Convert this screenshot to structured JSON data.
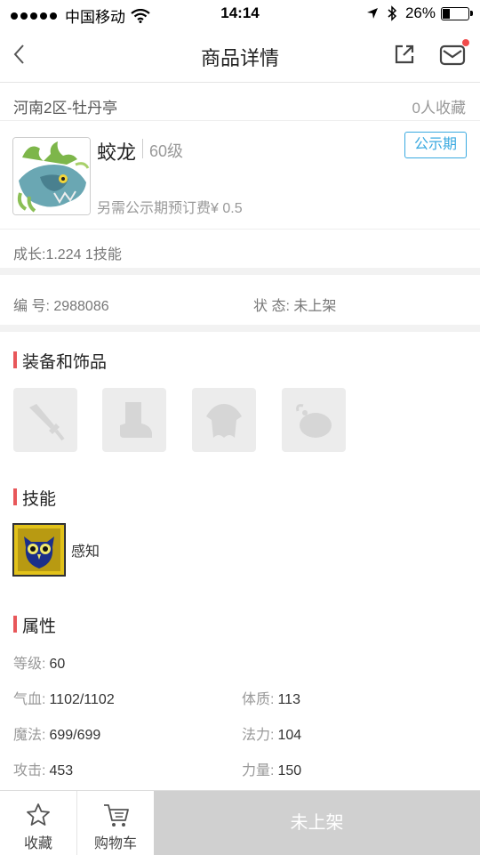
{
  "status_bar": {
    "carrier": "中国移动",
    "time": "14:14",
    "battery": "26%",
    "battery_level": 0.26
  },
  "nav": {
    "title": "商品详情",
    "back_icon": "chevron-left-icon",
    "share_icon": "share-icon",
    "mail_icon": "mail-icon"
  },
  "server": {
    "name": "河南2区-牡丹亭",
    "favorites": "0人收藏"
  },
  "pet": {
    "name": "蛟龙",
    "level": "60级",
    "badge": "公示期",
    "fee": "另需公示期预订费¥ 0.5",
    "growth": "成长:1.224 1技能"
  },
  "meta": {
    "id": "编 号:  2988086",
    "status": "状 态:  未上架"
  },
  "sections": {
    "equipment": "装备和饰品",
    "skills": "技能",
    "attributes": "属性"
  },
  "equipment": [
    {
      "icon": "sword-icon"
    },
    {
      "icon": "boot-icon"
    },
    {
      "icon": "armor-icon"
    },
    {
      "icon": "pouch-icon"
    }
  ],
  "skills": [
    {
      "name": "感知",
      "icon": "owl-icon"
    }
  ],
  "attributes": {
    "level": {
      "label": "等级:",
      "value": "60"
    },
    "hp": {
      "label": "气血:",
      "value": "1102/1102"
    },
    "constitution": {
      "label": "体质:",
      "value": "113"
    },
    "mp": {
      "label": "魔法:",
      "value": "699/699"
    },
    "magic": {
      "label": "法力:",
      "value": "104"
    },
    "attack": {
      "label": "攻击:",
      "value": "453"
    },
    "strength": {
      "label": "力量:",
      "value": "150"
    }
  },
  "bottom_bar": {
    "favorite": "收藏",
    "cart": "购物车",
    "main_action": "未上架"
  },
  "colors": {
    "accent_blue": "#39a9e0",
    "section_marker": "#e8575a",
    "disabled_button": "#d0d0d0",
    "notification_dot": "#f04b4b"
  }
}
